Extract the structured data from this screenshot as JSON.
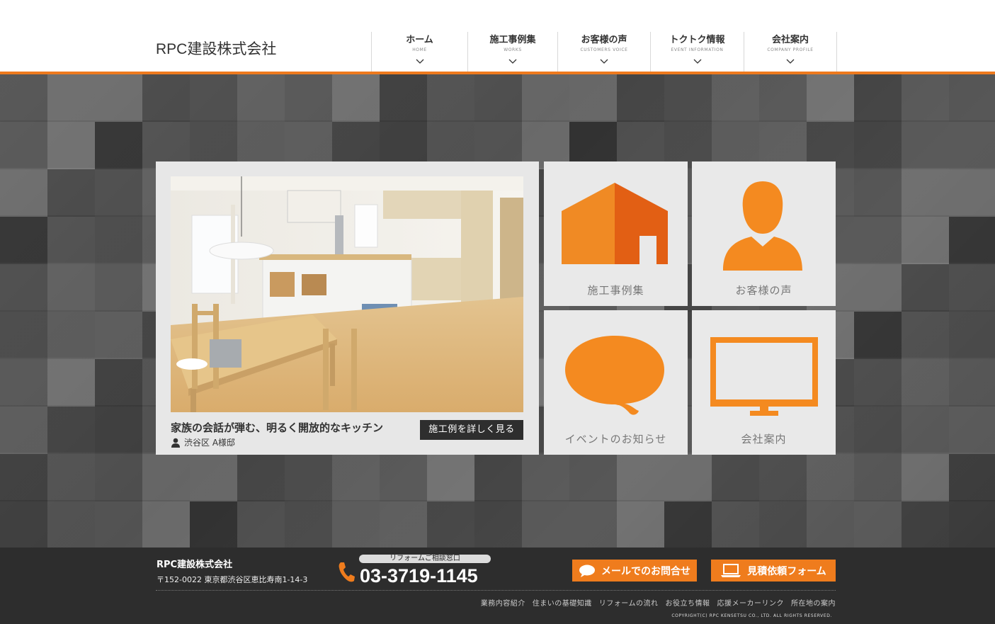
{
  "header": {
    "logo": "RPC建設株式会社",
    "nav": [
      {
        "jp": "ホーム",
        "en": "HOME"
      },
      {
        "jp": "施工事例集",
        "en": "WORKS"
      },
      {
        "jp": "お客様の声",
        "en": "CUSTOMERS VOICE"
      },
      {
        "jp": "トクトク情報",
        "en": "EVENT INFORMATION"
      },
      {
        "jp": "会社案内",
        "en": "COMPANY PROFILE"
      }
    ]
  },
  "feature": {
    "title": "家族の会話が弾む、明るく開放的なキッチン",
    "owner": "渋谷区 A様邸",
    "button": "施工例を詳しく見る"
  },
  "cards": {
    "works": "施工事例集",
    "voice": "お客様の声",
    "event": "イベントのお知らせ",
    "company": "会社案内"
  },
  "footer": {
    "company": "RPC建設株式会社",
    "address": "〒152-0022 東京都渋谷区恵比寿南1-14-3",
    "window_label": "リフォームご相談窓口",
    "tel": "03-3719-1145",
    "mail_button": "メールでのお問合せ",
    "estimate_button": "見積依頼フォーム",
    "links": [
      "業務内容紹介",
      "住まいの基礎知識",
      "リフォームの流れ",
      "お役立ち情報",
      "応援メーカーリンク",
      "所在地の案内"
    ],
    "copyright": "COPYRIGHT(C) RPC KENSETSU CO., LTD. ALL RIGHTS RESERVED."
  },
  "colors": {
    "accent": "#ee7a1e",
    "dark": "#2d2d2d",
    "card_bg": "#e9e9e9"
  },
  "icons": [
    "chevron-down-icon",
    "house-icon",
    "person-icon",
    "speech-bubble-icon",
    "monitor-icon",
    "phone-icon",
    "chat-icon",
    "laptop-icon",
    "user-icon"
  ]
}
